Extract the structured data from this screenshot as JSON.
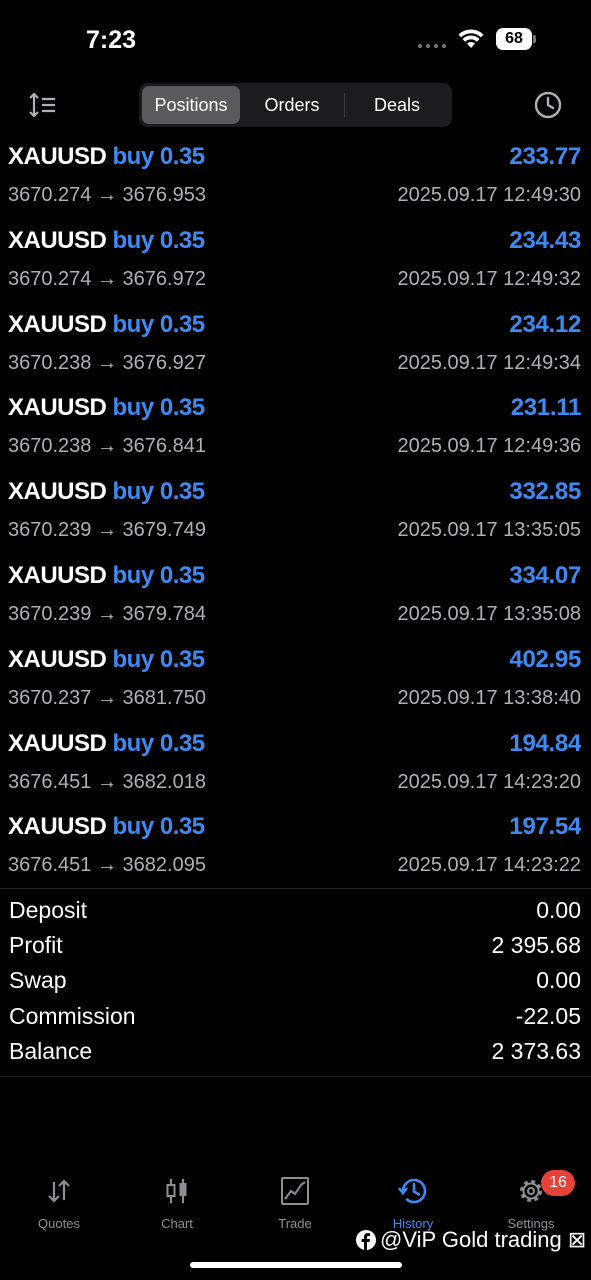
{
  "status_bar": {
    "time": "7:23",
    "battery": "68"
  },
  "toolbar": {
    "tabs": [
      {
        "label": "Positions",
        "active": true
      },
      {
        "label": "Orders",
        "active": false
      },
      {
        "label": "Deals",
        "active": false
      }
    ]
  },
  "deals": [
    {
      "symbol": "XAUUSD",
      "side": "buy 0.35",
      "prices": "3670.274 → 3676.953",
      "profit": "233.77",
      "time": "2025.09.17 12:49:30"
    },
    {
      "symbol": "XAUUSD",
      "side": "buy 0.35",
      "prices": "3670.274 → 3676.972",
      "profit": "234.43",
      "time": "2025.09.17 12:49:32"
    },
    {
      "symbol": "XAUUSD",
      "side": "buy 0.35",
      "prices": "3670.238 → 3676.927",
      "profit": "234.12",
      "time": "2025.09.17 12:49:34"
    },
    {
      "symbol": "XAUUSD",
      "side": "buy 0.35",
      "prices": "3670.238 → 3676.841",
      "profit": "231.11",
      "time": "2025.09.17 12:49:36"
    },
    {
      "symbol": "XAUUSD",
      "side": "buy 0.35",
      "prices": "3670.239 → 3679.749",
      "profit": "332.85",
      "time": "2025.09.17 13:35:05"
    },
    {
      "symbol": "XAUUSD",
      "side": "buy 0.35",
      "prices": "3670.239 → 3679.784",
      "profit": "334.07",
      "time": "2025.09.17 13:35:08"
    },
    {
      "symbol": "XAUUSD",
      "side": "buy 0.35",
      "prices": "3670.237 → 3681.750",
      "profit": "402.95",
      "time": "2025.09.17 13:38:40"
    },
    {
      "symbol": "XAUUSD",
      "side": "buy 0.35",
      "prices": "3676.451 → 3682.018",
      "profit": "194.84",
      "time": "2025.09.17 14:23:20"
    },
    {
      "symbol": "XAUUSD",
      "side": "buy 0.35",
      "prices": "3676.451 → 3682.095",
      "profit": "197.54",
      "time": "2025.09.17 14:23:22"
    }
  ],
  "summary": [
    {
      "label": "Deposit",
      "value": "0.00"
    },
    {
      "label": "Profit",
      "value": "2 395.68"
    },
    {
      "label": "Swap",
      "value": "0.00"
    },
    {
      "label": "Commission",
      "value": "-22.05"
    },
    {
      "label": "Balance",
      "value": "2 373.63"
    }
  ],
  "tabbar": {
    "items": [
      {
        "label": "Quotes",
        "icon": "quotes-icon"
      },
      {
        "label": "Chart",
        "icon": "chart-icon"
      },
      {
        "label": "Trade",
        "icon": "trade-icon"
      },
      {
        "label": "History",
        "icon": "history-icon",
        "active": true
      },
      {
        "label": "Settings",
        "icon": "settings-icon"
      }
    ],
    "settings_badge": "16"
  },
  "watermark": "@ViP Gold trading ⊠",
  "colors": {
    "accent": "#3d8bf2",
    "secondary_text": "#b0b0b5",
    "badge": "#e5423a"
  }
}
